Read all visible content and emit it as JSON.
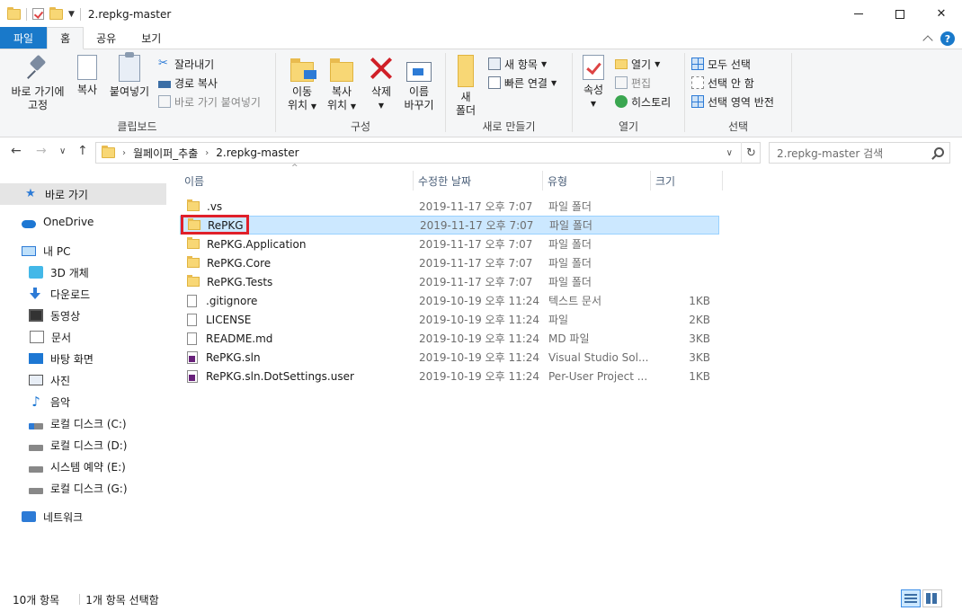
{
  "window": {
    "title": "2.repkg-master"
  },
  "ribbon_tabs": [
    "파일",
    "홈",
    "공유",
    "보기"
  ],
  "ribbon": {
    "clipboard": {
      "label": "클립보드",
      "pin_line1": "바로 가기에",
      "pin_line2": "고정",
      "copy": "복사",
      "paste": "붙여넣기",
      "cut": "잘라내기",
      "copy_path": "경로 복사",
      "paste_shortcut": "바로 가기 붙여넣기"
    },
    "organize": {
      "label": "구성",
      "move_line1": "이동",
      "move_line2": "위치",
      "copy_line1": "복사",
      "copy_line2": "위치",
      "delete": "삭제",
      "rename_line1": "이름",
      "rename_line2": "바꾸기"
    },
    "new": {
      "label": "새로 만들기",
      "new_folder_line1": "새",
      "new_folder_line2": "폴더",
      "new_item": "새 항목",
      "easy_access": "빠른 연결"
    },
    "open": {
      "label": "열기",
      "properties": "속성",
      "open": "열기",
      "edit": "편집",
      "history": "히스토리"
    },
    "select": {
      "label": "선택",
      "select_all": "모두 선택",
      "select_none": "선택 안 함",
      "invert": "선택 영역 반전"
    }
  },
  "address": {
    "crumbs": [
      "월페이퍼_추출",
      "2.repkg-master"
    ],
    "search_placeholder": "2.repkg-master 검색"
  },
  "nav": {
    "quick_access": "바로 가기",
    "onedrive": "OneDrive",
    "this_pc": "내 PC",
    "objects3d": "3D 개체",
    "downloads": "다운로드",
    "videos": "동영상",
    "documents": "문서",
    "desktop": "바탕 화면",
    "pictures": "사진",
    "music": "음악",
    "drive_c": "로컬 디스크 (C:)",
    "drive_d": "로컬 디스크 (D:)",
    "drive_e": "시스템 예약 (E:)",
    "drive_g": "로컬 디스크 (G:)",
    "network": "네트워크"
  },
  "columns": {
    "name": "이름",
    "date": "수정한 날짜",
    "type": "유형",
    "size": "크기"
  },
  "files": [
    {
      "name": ".vs",
      "date": "2019-11-17 오후 7:07",
      "type": "파일 폴더",
      "size": "",
      "kind": "folder"
    },
    {
      "name": "RePKG",
      "date": "2019-11-17 오후 7:07",
      "type": "파일 폴더",
      "size": "",
      "kind": "folder"
    },
    {
      "name": "RePKG.Application",
      "date": "2019-11-17 오후 7:07",
      "type": "파일 폴더",
      "size": "",
      "kind": "folder"
    },
    {
      "name": "RePKG.Core",
      "date": "2019-11-17 오후 7:07",
      "type": "파일 폴더",
      "size": "",
      "kind": "folder"
    },
    {
      "name": "RePKG.Tests",
      "date": "2019-11-17 오후 7:07",
      "type": "파일 폴더",
      "size": "",
      "kind": "folder"
    },
    {
      "name": ".gitignore",
      "date": "2019-10-19 오후 11:24",
      "type": "텍스트 문서",
      "size": "1KB",
      "kind": "file"
    },
    {
      "name": "LICENSE",
      "date": "2019-10-19 오후 11:24",
      "type": "파일",
      "size": "2KB",
      "kind": "file"
    },
    {
      "name": "README.md",
      "date": "2019-10-19 오후 11:24",
      "type": "MD 파일",
      "size": "3KB",
      "kind": "file"
    },
    {
      "name": "RePKG.sln",
      "date": "2019-10-19 오후 11:24",
      "type": "Visual Studio Sol...",
      "size": "3KB",
      "kind": "sln"
    },
    {
      "name": "RePKG.sln.DotSettings.user",
      "date": "2019-10-19 오후 11:24",
      "type": "Per-User Project ...",
      "size": "1KB",
      "kind": "sln"
    }
  ],
  "status": {
    "count": "10개 항목",
    "selected": "1개 항목 선택함"
  },
  "colors": {
    "accent": "#1979ca",
    "selection": "#cce8ff",
    "highlight_box": "#e0202a",
    "folder": "#f8d775"
  }
}
